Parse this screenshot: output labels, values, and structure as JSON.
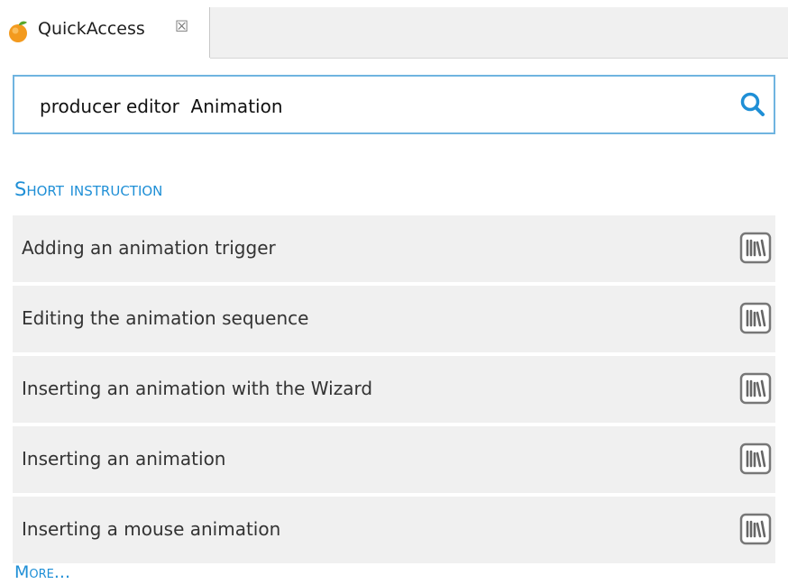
{
  "tab": {
    "icon": "orange-icon",
    "label": "QuickAccess",
    "close_glyph": "☒"
  },
  "search": {
    "value": "producer editor  Animation",
    "icon": "search-icon",
    "accent_color": "#1f8fd6"
  },
  "section": {
    "title": "Short instruction"
  },
  "items": [
    {
      "label": "Adding an animation trigger",
      "icon": "book-icon"
    },
    {
      "label": "Editing the animation sequence",
      "icon": "book-icon"
    },
    {
      "label": "Inserting an animation with the Wizard",
      "icon": "book-icon"
    },
    {
      "label": "Inserting an animation",
      "icon": "book-icon"
    },
    {
      "label": "Inserting a mouse animation",
      "icon": "book-icon"
    }
  ],
  "more": {
    "label": "More..."
  },
  "colors": {
    "accent": "#1f8fd6",
    "row_background": "#f0f0f0",
    "search_border": "#6fb4e0"
  }
}
